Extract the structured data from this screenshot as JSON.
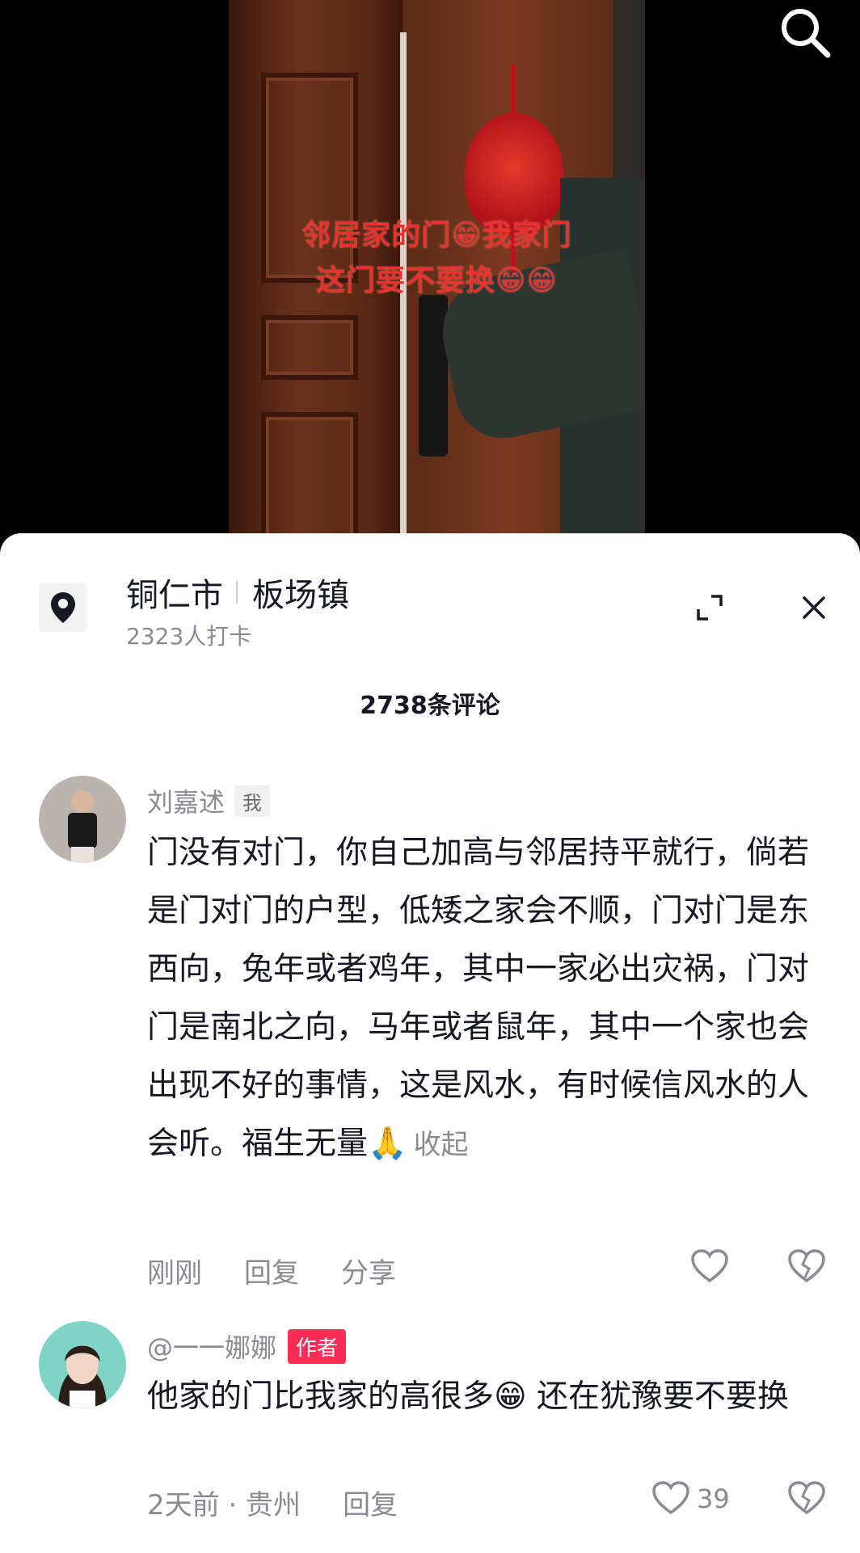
{
  "video": {
    "overlay_line1": "邻居家的门😁我家门",
    "overlay_line2": "这门要不要换😁😁"
  },
  "top_bar": {
    "search_icon": "search-icon"
  },
  "location": {
    "city": "铜仁市",
    "town": "板场镇",
    "checkins": "2323人打卡",
    "icon": "location-pin-icon"
  },
  "controls": {
    "expand_icon": "expand-icon",
    "close_icon": "close-icon"
  },
  "comments_header": {
    "count_label": "2738条评论"
  },
  "comments": [
    {
      "username": "刘嘉述",
      "tag": "我",
      "text": "门没有对门，你自己加高与邻居持平就行，倘若是门对门的户型，低矮之家会不顺，门对门是东西向，兔年或者鸡年，其中一家必出灾祸，门对门是南北之向，马年或者鼠年，其中一个家也会出现不好的事情，这是风水，有时候信风水的人会听。福生无量🙏",
      "collapse_label": "收起",
      "time": "刚刚",
      "reply_label": "回复",
      "share_label": "分享",
      "like_icon": "heart-icon",
      "dislike_icon": "broken-heart-icon"
    },
    {
      "username": "@一一娜娜",
      "tag": "作者",
      "text": "他家的门比我家的高很多😁 还在犹豫要不要换",
      "time_location": "2天前 · 贵州",
      "reply_label": "回复",
      "likes": "39",
      "like_icon": "heart-icon",
      "dislike_icon": "broken-heart-icon"
    }
  ],
  "colors": {
    "author_tag": "#fe2c55",
    "overlay_text": "#e8322b",
    "secondary_text": "#8a8b91"
  }
}
